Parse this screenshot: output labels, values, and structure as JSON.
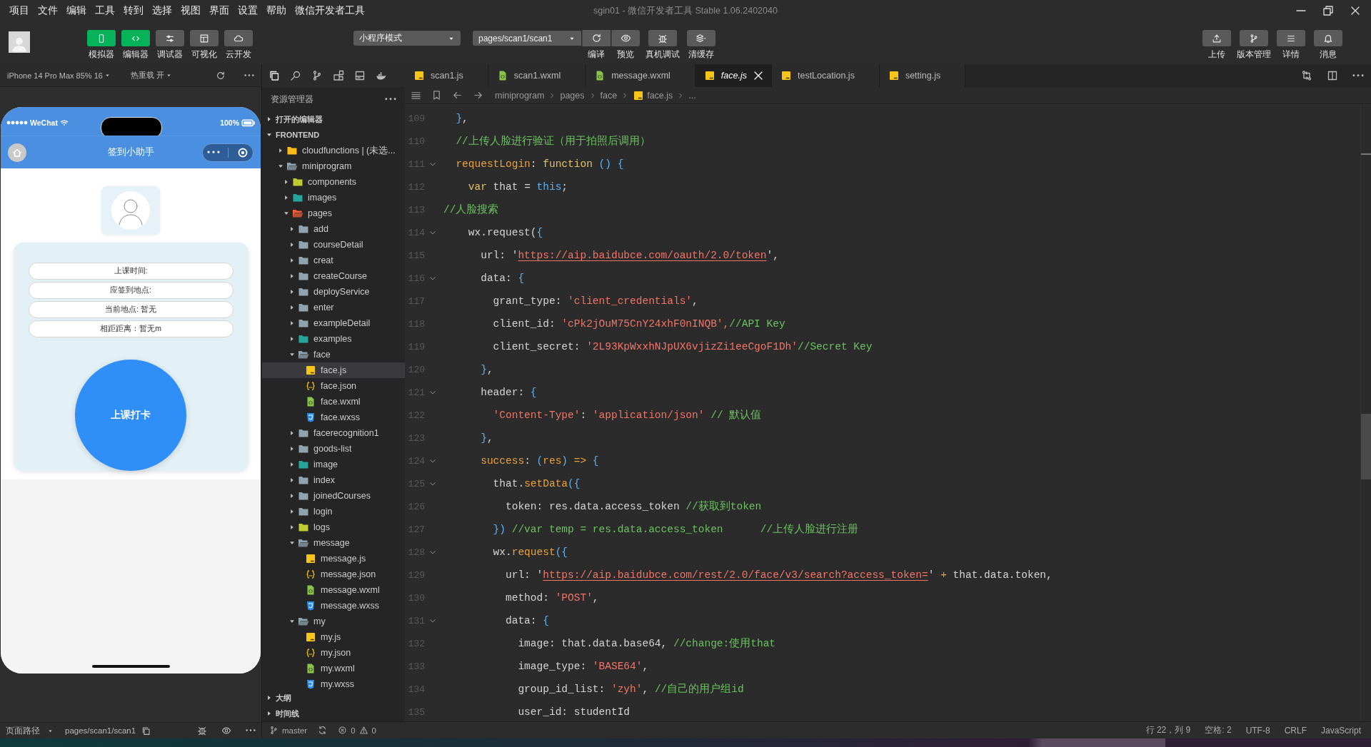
{
  "window": {
    "title": "sgin01 - 微信开发者工具 Stable 1.06.2402040"
  },
  "menu": [
    "项目",
    "文件",
    "编辑",
    "工具",
    "转到",
    "选择",
    "视图",
    "界面",
    "设置",
    "帮助",
    "微信开发者工具"
  ],
  "toolbar": {
    "tools": [
      {
        "label": "模拟器",
        "kind": "phone",
        "on": true
      },
      {
        "label": "编辑器",
        "kind": "code",
        "on": true
      },
      {
        "label": "调试器",
        "kind": "debug",
        "on": false
      },
      {
        "label": "可视化",
        "kind": "layout",
        "on": false
      },
      {
        "label": "云开发",
        "kind": "cloud",
        "on": false
      }
    ],
    "mode": "小程序模式",
    "page": "pages/scan1/scan1",
    "page_actions": [
      {
        "label": "编译",
        "kind": "refresh"
      },
      {
        "label": "预览",
        "kind": "eye"
      }
    ],
    "actions": [
      {
        "label": "真机调试",
        "kind": "bug"
      },
      {
        "label": "清缓存",
        "kind": "layers"
      }
    ],
    "right_actions": [
      {
        "label": "上传",
        "kind": "upload"
      },
      {
        "label": "版本管理",
        "kind": "branch"
      },
      {
        "label": "详情",
        "kind": "list"
      },
      {
        "label": "消息",
        "kind": "bell"
      }
    ]
  },
  "simulator": {
    "device": "iPhone 14 Pro Max 85% 16",
    "hot_reload": "热重载 开",
    "carrier": "WeChat",
    "battery": "100%",
    "nav_title": "签到小助手",
    "info_rows": [
      "上课时间:",
      "应签到地点:",
      "当前地点: 暂无",
      "相距距离：暂无m"
    ],
    "check_in": "上课打卡",
    "path_label": "页面路径",
    "path": "pages/scan1/scan1"
  },
  "explorer": {
    "title": "资源管理器",
    "sections": [
      {
        "label": "打开的编辑器",
        "expanded": false
      },
      {
        "label": "FRONTEND",
        "expanded": true
      }
    ],
    "tree": [
      {
        "label": "cloudfunctions | (未选...",
        "kind": "cloud",
        "expanded": false,
        "selected": false
      },
      {
        "label": "miniprogram",
        "kind": "folder",
        "expanded": true,
        "selected": false,
        "children": [
          {
            "label": "components",
            "kind": "components",
            "expanded": false,
            "selected": false
          },
          {
            "label": "images",
            "kind": "images",
            "expanded": false,
            "selected": false
          },
          {
            "label": "pages",
            "kind": "pages",
            "expanded": true,
            "selected": false,
            "children": [
              {
                "label": "add",
                "kind": "folder",
                "expanded": false,
                "selected": false
              },
              {
                "label": "courseDetail",
                "kind": "folder",
                "expanded": false,
                "selected": false
              },
              {
                "label": "creat",
                "kind": "folder",
                "expanded": false,
                "selected": false
              },
              {
                "label": "createCourse",
                "kind": "folder",
                "expanded": false,
                "selected": false
              },
              {
                "label": "deployService",
                "kind": "folder",
                "expanded": false,
                "selected": false
              },
              {
                "label": "enter",
                "kind": "folder",
                "expanded": false,
                "selected": false
              },
              {
                "label": "exampleDetail",
                "kind": "folder",
                "expanded": false,
                "selected": false
              },
              {
                "label": "examples",
                "kind": "images",
                "expanded": false,
                "selected": false
              },
              {
                "label": "face",
                "kind": "folder",
                "expanded": true,
                "selected": false,
                "children": [
                  {
                    "label": "face.js",
                    "kind": "js",
                    "selected": true
                  },
                  {
                    "label": "face.json",
                    "kind": "json",
                    "selected": false
                  },
                  {
                    "label": "face.wxml",
                    "kind": "wxml",
                    "selected": false
                  },
                  {
                    "label": "face.wxss",
                    "kind": "wxss",
                    "selected": false
                  }
                ]
              },
              {
                "label": "facerecognition1",
                "kind": "folder",
                "expanded": false,
                "selected": false
              },
              {
                "label": "goods-list",
                "kind": "folder",
                "expanded": false,
                "selected": false
              },
              {
                "label": "image",
                "kind": "images",
                "expanded": false,
                "selected": false
              },
              {
                "label": "index",
                "kind": "folder",
                "expanded": false,
                "selected": false
              },
              {
                "label": "joinedCourses",
                "kind": "folder",
                "expanded": false,
                "selected": false
              },
              {
                "label": "login",
                "kind": "folder",
                "expanded": false,
                "selected": false
              },
              {
                "label": "logs",
                "kind": "logs",
                "expanded": false,
                "selected": false
              },
              {
                "label": "message",
                "kind": "folder",
                "expanded": true,
                "selected": false,
                "children": [
                  {
                    "label": "message.js",
                    "kind": "js",
                    "selected": false
                  },
                  {
                    "label": "message.json",
                    "kind": "json",
                    "selected": false
                  },
                  {
                    "label": "message.wxml",
                    "kind": "wxml",
                    "selected": false
                  },
                  {
                    "label": "message.wxss",
                    "kind": "wxss",
                    "selected": false
                  }
                ]
              },
              {
                "label": "my",
                "kind": "folder",
                "expanded": true,
                "selected": false,
                "children": [
                  {
                    "label": "my.js",
                    "kind": "js",
                    "selected": false
                  },
                  {
                    "label": "my.json",
                    "kind": "json",
                    "selected": false
                  },
                  {
                    "label": "my.wxml",
                    "kind": "wxml",
                    "selected": false
                  },
                  {
                    "label": "my.wxss",
                    "kind": "wxss",
                    "selected": false
                  }
                ]
              }
            ]
          }
        ]
      }
    ],
    "panels": [
      {
        "label": "大纲",
        "expanded": false
      },
      {
        "label": "时间线",
        "expanded": false
      }
    ],
    "branch": "master",
    "errors": "0",
    "warnings": "0"
  },
  "editor": {
    "tabs": [
      {
        "label": "scan1.js",
        "kind": "js",
        "selected": false
      },
      {
        "label": "scan1.wxml",
        "kind": "wxml",
        "selected": false
      },
      {
        "label": "message.wxml",
        "kind": "wxml",
        "selected": false
      },
      {
        "label": "face.js",
        "kind": "js",
        "selected": true
      },
      {
        "label": "testLocation.js",
        "kind": "js",
        "selected": false
      },
      {
        "label": "setting.js",
        "kind": "js",
        "selected": false
      }
    ],
    "breadcrumb": [
      {
        "label": "miniprogram",
        "kind": "folder"
      },
      {
        "label": "pages",
        "kind": "folder"
      },
      {
        "label": "face",
        "kind": "folder"
      },
      {
        "label": "face.js",
        "kind": "js"
      },
      {
        "label": "...",
        "kind": "more"
      }
    ],
    "lines": [
      {
        "number": "109",
        "foldable": false,
        "tokens": [
          {
            "kind": "punct",
            "text": "  }"
          },
          {
            "kind": "plain",
            "text": ","
          }
        ]
      },
      {
        "number": "110",
        "foldable": false,
        "tokens": [
          {
            "kind": "comment",
            "text": "  //上传人脸进行验证（用于拍照后调用）"
          }
        ]
      },
      {
        "number": "111",
        "foldable": true,
        "tokens": [
          {
            "kind": "name",
            "text": "  requestLogin"
          },
          {
            "kind": "plain",
            "text": ": "
          },
          {
            "kind": "keyword",
            "text": "function"
          },
          {
            "kind": "punct",
            "text": " () {"
          }
        ]
      },
      {
        "number": "112",
        "foldable": false,
        "tokens": [
          {
            "kind": "keyword",
            "text": "    var"
          },
          {
            "kind": "plain",
            "text": " that = "
          },
          {
            "kind": "punct",
            "text": "this"
          },
          {
            "kind": "plain",
            "text": ";"
          }
        ]
      },
      {
        "number": "113",
        "foldable": false,
        "tokens": [
          {
            "kind": "comment",
            "text": "//人脸搜索"
          }
        ]
      },
      {
        "number": "114",
        "foldable": true,
        "tokens": [
          {
            "kind": "plain",
            "text": "    wx.request("
          },
          {
            "kind": "punct",
            "text": "{"
          }
        ]
      },
      {
        "number": "115",
        "foldable": false,
        "tokens": [
          {
            "kind": "plain",
            "text": "      url: '"
          },
          {
            "kind": "link",
            "text": "https://aip.baidubce.com/oauth/2.0/token"
          },
          {
            "kind": "plain",
            "text": "',"
          }
        ]
      },
      {
        "number": "116",
        "foldable": true,
        "tokens": [
          {
            "kind": "plain",
            "text": "      data: "
          },
          {
            "kind": "punct",
            "text": "{"
          }
        ]
      },
      {
        "number": "117",
        "foldable": false,
        "tokens": [
          {
            "kind": "plain",
            "text": "        grant_type: "
          },
          {
            "kind": "string",
            "text": "'client_credentials'"
          },
          {
            "kind": "plain",
            "text": ","
          }
        ]
      },
      {
        "number": "118",
        "foldable": false,
        "tokens": [
          {
            "kind": "plain",
            "text": "        client_id: "
          },
          {
            "kind": "string",
            "text": "'cPk2jOuM75CnY24xhF0nINQB',"
          },
          {
            "kind": "comment",
            "text": "//API Key"
          }
        ]
      },
      {
        "number": "119",
        "foldable": false,
        "tokens": [
          {
            "kind": "plain",
            "text": "        client_secret: "
          },
          {
            "kind": "string",
            "text": "'2L93KpWxxhNJpUX6vjizZi1eeCgoF1Dh'"
          },
          {
            "kind": "comment",
            "text": "//Secret Key"
          }
        ]
      },
      {
        "number": "120",
        "foldable": false,
        "tokens": [
          {
            "kind": "punct",
            "text": "      }"
          },
          {
            "kind": "plain",
            "text": ","
          }
        ]
      },
      {
        "number": "121",
        "foldable": true,
        "tokens": [
          {
            "kind": "plain",
            "text": "      header: "
          },
          {
            "kind": "punct",
            "text": "{"
          }
        ]
      },
      {
        "number": "122",
        "foldable": false,
        "tokens": [
          {
            "kind": "string",
            "text": "        'Content-Type'"
          },
          {
            "kind": "plain",
            "text": ": "
          },
          {
            "kind": "string",
            "text": "'application/json'"
          },
          {
            "kind": "comment",
            "text": " // 默认值"
          }
        ]
      },
      {
        "number": "123",
        "foldable": false,
        "tokens": [
          {
            "kind": "punct",
            "text": "      }"
          },
          {
            "kind": "plain",
            "text": ","
          }
        ]
      },
      {
        "number": "124",
        "foldable": true,
        "tokens": [
          {
            "kind": "name",
            "text": "      success"
          },
          {
            "kind": "plain",
            "text": ": "
          },
          {
            "kind": "punct",
            "text": "("
          },
          {
            "kind": "name",
            "text": "res"
          },
          {
            "kind": "punct",
            "text": ")"
          },
          {
            "kind": "name",
            "text": " =>"
          },
          {
            "kind": "punct",
            "text": " {"
          }
        ]
      },
      {
        "number": "125",
        "foldable": true,
        "tokens": [
          {
            "kind": "plain",
            "text": "        that."
          },
          {
            "kind": "name",
            "text": "setData"
          },
          {
            "kind": "punct",
            "text": "({"
          }
        ]
      },
      {
        "number": "126",
        "foldable": false,
        "tokens": [
          {
            "kind": "plain",
            "text": "          token: res.data.access_token "
          },
          {
            "kind": "comment",
            "text": "//获取到token"
          }
        ]
      },
      {
        "number": "127",
        "foldable": false,
        "tokens": [
          {
            "kind": "punct",
            "text": "        })"
          },
          {
            "kind": "comment",
            "text": " //var temp = res.data.access_token      //上传人脸进行注册"
          }
        ]
      },
      {
        "number": "128",
        "foldable": true,
        "tokens": [
          {
            "kind": "plain",
            "text": "        wx."
          },
          {
            "kind": "name",
            "text": "request"
          },
          {
            "kind": "punct",
            "text": "({"
          }
        ]
      },
      {
        "number": "129",
        "foldable": false,
        "tokens": [
          {
            "kind": "plain",
            "text": "          url: '"
          },
          {
            "kind": "link",
            "text": "https://aip.baidubce.com/rest/2.0/face/v3/search?access_token="
          },
          {
            "kind": "plain",
            "text": "' "
          },
          {
            "kind": "name",
            "text": "+"
          },
          {
            "kind": "plain",
            "text": " that.data.token,"
          }
        ]
      },
      {
        "number": "130",
        "foldable": false,
        "tokens": [
          {
            "kind": "plain",
            "text": "          method: "
          },
          {
            "kind": "string",
            "text": "'POST'"
          },
          {
            "kind": "plain",
            "text": ","
          }
        ]
      },
      {
        "number": "131",
        "foldable": true,
        "tokens": [
          {
            "kind": "plain",
            "text": "          data: "
          },
          {
            "kind": "punct",
            "text": "{"
          }
        ]
      },
      {
        "number": "132",
        "foldable": false,
        "tokens": [
          {
            "kind": "plain",
            "text": "            image: that.data.base64, "
          },
          {
            "kind": "comment",
            "text": "//change:使用that"
          }
        ]
      },
      {
        "number": "133",
        "foldable": false,
        "tokens": [
          {
            "kind": "plain",
            "text": "            image_type: "
          },
          {
            "kind": "string",
            "text": "'BASE64'"
          },
          {
            "kind": "plain",
            "text": ","
          }
        ]
      },
      {
        "number": "134",
        "foldable": false,
        "tokens": [
          {
            "kind": "plain",
            "text": "            group_id_list: "
          },
          {
            "kind": "string",
            "text": "'zyh'"
          },
          {
            "kind": "plain",
            "text": ", "
          },
          {
            "kind": "comment",
            "text": "//自己的用户组id"
          }
        ]
      },
      {
        "number": "135",
        "foldable": false,
        "tokens": [
          {
            "kind": "plain",
            "text": "            user_id: studentId"
          }
        ]
      }
    ]
  },
  "status_bar": {
    "position": "行 22，列 9",
    "indent": "空格: 2",
    "encoding": "UTF-8",
    "eol": "CRLF",
    "language": "JavaScript"
  }
}
